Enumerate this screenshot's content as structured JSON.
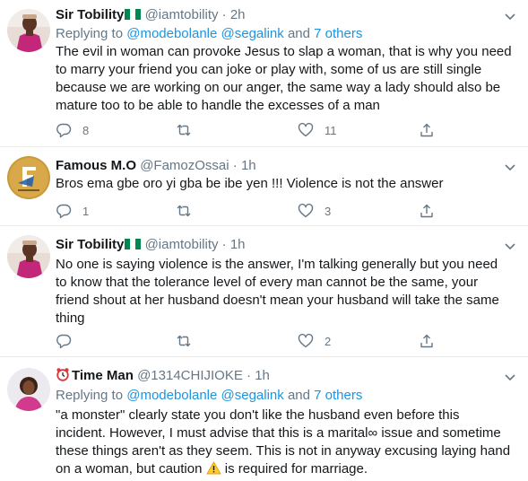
{
  "tweets": [
    {
      "name": "Sir Tobility",
      "handle": "@iamtobility",
      "dot": "·",
      "time": "2h",
      "reply_prefix": "Replying to",
      "reply_mentions": "@modebolanle @segalink",
      "reply_and": "and",
      "reply_others": "7 others",
      "text": "The evil in woman can provoke Jesus to slap a woman, that is why you need to marry your friend you can joke or play with, some of us are still single because we are working on our anger, the same way a lady should also be mature too to be able to handle the excesses of a man",
      "replies": "8",
      "likes": "11"
    },
    {
      "name": "Famous M.O",
      "handle": "@FamozOssai",
      "dot": "·",
      "time": "1h",
      "text": "Bros ema gbe oro yi gba be ibe yen !!! Violence is not the answer",
      "replies": "1",
      "likes": "3"
    },
    {
      "name": "Sir Tobility",
      "handle": "@iamtobility",
      "dot": "·",
      "time": "1h",
      "text": "No one is saying violence is the answer, I'm talking generally but you need to know that the tolerance level of every man cannot be the same, your friend shout at her husband doesn't mean your husband will take the same thing",
      "likes": "2"
    },
    {
      "name": "Time Man",
      "handle": "@1314CHIJIOKE",
      "dot": "·",
      "time": "1h",
      "reply_prefix": "Replying to",
      "reply_mentions": "@modebolanle @segalink",
      "reply_and": "and",
      "reply_others": "7 others",
      "text_a": "\"a monster\" clearly state you don't like the husband even before this incident. However, I must advise that this is a marital∞ issue and sometime these things aren't as they seem. This is not in anyway excusing laying hand on a woman, but caution",
      "text_b": "is required for marriage."
    }
  ],
  "icons": [
    "nigeria-flag-icon",
    "alarm-clock-icon",
    "warning-icon",
    "reply-icon",
    "retweet-icon",
    "like-icon",
    "share-icon",
    "chevron-down-icon"
  ],
  "colors": {
    "link": "#1b95e0",
    "secondary": "#657786",
    "text": "#14171a",
    "divider": "#e6ecf0"
  }
}
